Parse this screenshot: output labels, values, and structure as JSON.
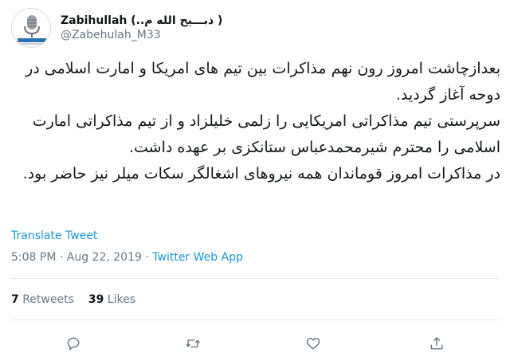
{
  "author": {
    "display_name": "Zabihullah (..ذبـــیح الله م )",
    "handle": "@Zabehulah_M33"
  },
  "tweet": {
    "paragraphs": [
      "بعدازچاشت امروز رون نهم مذاکرات بین تیم های امریکا و امارت اسلامی در دوحه آغاز گردید.",
      "سرپرستی تیم مذاکراتی امریکایی را زلمی خلیلزاد و از تیم مذاکراتی امارت اسلامی را محترم شیرمحمدعباس ستانکزی بر عهده داشت.",
      "در مذاکرات امروز قوماندان همه نیروهای اشغالگر سکات میلر نیز حاضر بود."
    ],
    "translate_label": "Translate Tweet",
    "timestamp": "5:08 PM · Aug 22, 2019",
    "separator": " · ",
    "source_app": "Twitter Web App"
  },
  "stats": {
    "retweets_count": "7",
    "retweets_label": " Retweets",
    "likes_count": "39",
    "likes_label": " Likes"
  },
  "icons": {
    "avatar": "microphone-logo",
    "reply": "reply-icon",
    "retweet": "retweet-icon",
    "like": "heart-icon",
    "share": "share-icon"
  },
  "colors": {
    "link": "#1b95e0",
    "secondary_text": "#657786",
    "icon": "#657786"
  }
}
